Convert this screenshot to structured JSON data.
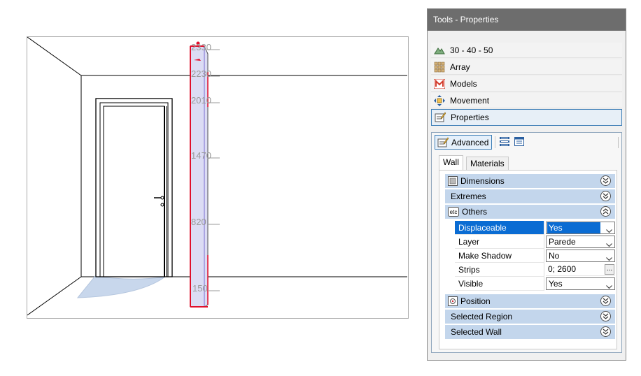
{
  "viewport": {
    "dimension_labels": [
      "2330",
      "2230",
      "2010",
      "1470",
      "820",
      "150"
    ]
  },
  "panel": {
    "title": "Tools - Properties",
    "tools": [
      {
        "label": "30 - 40 - 50",
        "icon": "terrain-icon"
      },
      {
        "label": "Array",
        "icon": "array-icon"
      },
      {
        "label": "Models",
        "icon": "models-icon"
      },
      {
        "label": "Movement",
        "icon": "movement-icon"
      },
      {
        "label": "Properties",
        "icon": "properties-icon",
        "active": true
      }
    ],
    "toolbar": {
      "advanced_label": "Advanced"
    },
    "tabs": [
      {
        "label": "Wall",
        "active": true
      },
      {
        "label": "Materials",
        "active": false
      }
    ],
    "groups": {
      "dimensions": "Dimensions",
      "extremes": "Extremes",
      "others": "Others",
      "position": "Position",
      "selected_region": "Selected Region",
      "selected_wall": "Selected Wall"
    },
    "others_icon_text": "etc",
    "properties": [
      {
        "name": "Displaceable",
        "value": "Yes",
        "selected": true
      },
      {
        "name": "Layer",
        "value": "Parede"
      },
      {
        "name": "Make Shadow",
        "value": "No"
      },
      {
        "name": "Strips",
        "value": "0; 2600",
        "button": "..."
      },
      {
        "name": "Visible",
        "value": "Yes"
      }
    ]
  },
  "colors": {
    "title_bar": "#6d6d6d",
    "group_header": "#c3d6ec",
    "selection": "#0a6cd3",
    "wall_fill": "#dcdcf4",
    "wall_outline": "#e0102c",
    "door_swing": "#c8d7ec"
  }
}
